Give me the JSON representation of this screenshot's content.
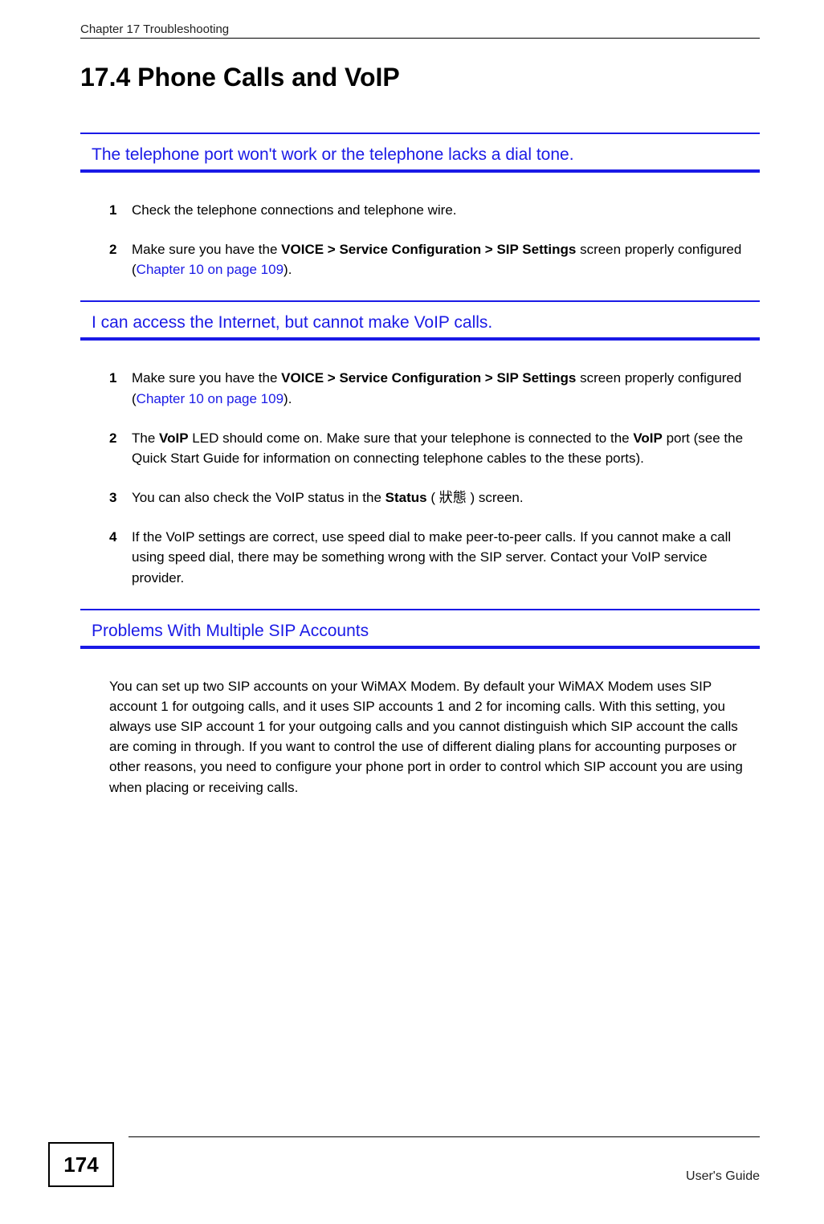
{
  "running_head": "Chapter 17 Troubleshooting",
  "section_heading": "17.4  Phone Calls and VoIP",
  "callout1": {
    "label": "The telephone port won't work or the telephone lacks a dial tone."
  },
  "list1": {
    "item1": {
      "num": "1",
      "text": "Check the telephone connections and telephone wire."
    },
    "item2": {
      "num": "2",
      "pre": "Make sure you have the ",
      "bold": "VOICE > Service Configuration > SIP Settings",
      "mid": " screen properly configured (",
      "link": "Chapter 10 on page 109",
      "post": ")."
    }
  },
  "callout2": {
    "label": "I can access the Internet, but cannot make VoIP calls."
  },
  "list2": {
    "item1": {
      "num": "1",
      "pre": "Make sure you have the ",
      "bold": "VOICE > Service Configuration > SIP Settings",
      "mid": " screen properly configured (",
      "link": "Chapter 10 on page 109",
      "post": ")."
    },
    "item2": {
      "num": "2",
      "pre": "The ",
      "bold1": "VoIP",
      "mid1": " LED should come on. Make sure that your telephone is connected to the ",
      "bold2": "VoIP",
      "post": " port (see the Quick Start Guide for information on connecting telephone cables to the these ports)."
    },
    "item3": {
      "num": "3",
      "pre": "You can also check the VoIP status in the ",
      "bold": "Status",
      "cjk": " ( 狀態 ) ",
      "post": "screen."
    },
    "item4": {
      "num": "4",
      "text": "If the VoIP settings are correct, use speed dial to make peer-to-peer calls. If you cannot make a call using speed dial, there may be something wrong with the SIP server. Contact your VoIP service provider."
    }
  },
  "callout3": {
    "label": "Problems With Multiple SIP Accounts"
  },
  "paragraph": "You can set up two SIP accounts on your WiMAX Modem. By default your WiMAX Modem uses SIP account 1 for outgoing calls, and it uses SIP accounts 1 and 2 for incoming calls. With this setting, you always use SIP account 1 for your outgoing calls and you cannot distinguish which SIP account the calls are coming in through. If you want to control the use of different dialing plans for accounting purposes or other reasons, you need to configure your phone port in order to control which SIP account you are using when placing or receiving calls.",
  "footer": {
    "page_number": "174",
    "guide_label": "User's Guide"
  }
}
